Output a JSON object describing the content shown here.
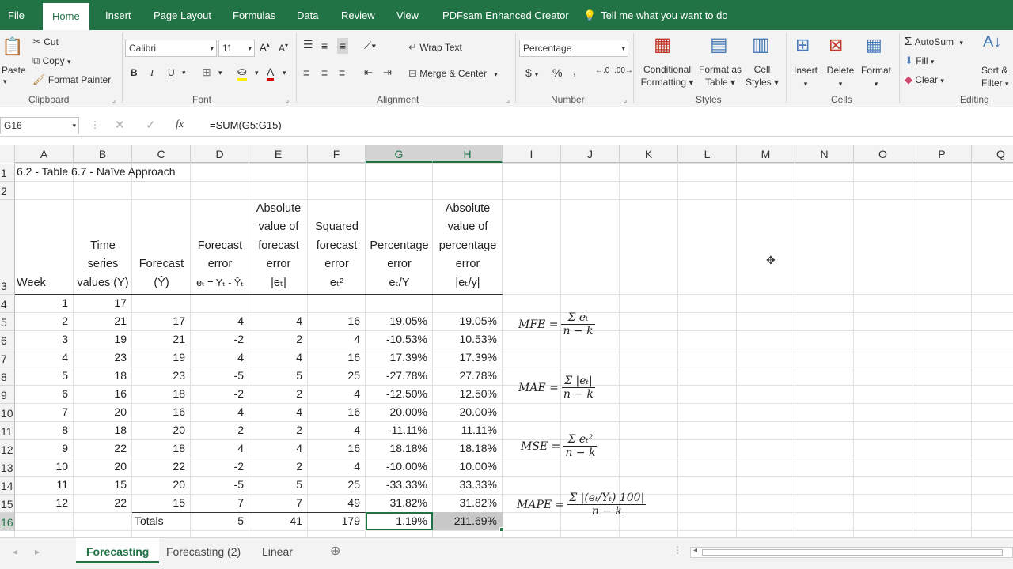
{
  "ribbon_tabs": [
    "File",
    "Home",
    "Insert",
    "Page Layout",
    "Formulas",
    "Data",
    "Review",
    "View",
    "PDFsam Enhanced Creator"
  ],
  "tell_me": "Tell me what you want to do",
  "clipboard": {
    "paste": "Paste",
    "cut": "Cut",
    "copy": "Copy",
    "format_painter": "Format Painter",
    "group": "Clipboard"
  },
  "font": {
    "name": "Calibri",
    "size": "11",
    "bold": "B",
    "italic": "I",
    "underline": "U",
    "grow": "A",
    "shrink": "A",
    "group": "Font"
  },
  "alignment": {
    "wrap_text": "Wrap Text",
    "merge_center": "Merge & Center",
    "group": "Alignment"
  },
  "number": {
    "format": "Percentage",
    "currency": "$",
    "percent": "%",
    "comma": ",",
    "group": "Number"
  },
  "styles": {
    "conditional": "Conditional",
    "formatting": "Formatting",
    "format_as": "Format as",
    "table": "Table",
    "cell": "Cell",
    "cell_styles": "Styles",
    "group": "Styles"
  },
  "cells": {
    "insert": "Insert",
    "delete": "Delete",
    "format": "Format",
    "group": "Cells"
  },
  "editing": {
    "autosum": "AutoSum",
    "fill": "Fill",
    "clear": "Clear",
    "sort": "Sort &",
    "filter": "Filter",
    "group": "Editing"
  },
  "formula_bar": {
    "name_box": "G16",
    "fx": "fx",
    "formula": "=SUM(G5:G15)"
  },
  "columns": [
    "A",
    "B",
    "C",
    "D",
    "E",
    "F",
    "G",
    "H",
    "I",
    "J",
    "K",
    "L",
    "M",
    "N",
    "O",
    "P",
    "Q"
  ],
  "rows": [
    "1",
    "2",
    "3",
    "4",
    "5",
    "6",
    "7",
    "8",
    "9",
    "10",
    "11",
    "12",
    "13",
    "14",
    "15",
    "16"
  ],
  "title": "6.2 - Table 6.7 - Naïve Approach",
  "headers": {
    "A": "Week",
    "B": [
      "Time",
      "series",
      "values (Y)"
    ],
    "C": [
      "Forecast",
      "(Ŷ)"
    ],
    "D": [
      "Forecast",
      "error",
      "eₜ = Yₜ - Ŷₜ"
    ],
    "E": [
      "Absolute",
      "value of",
      "forecast",
      "error",
      "|eₜ|"
    ],
    "F": [
      "Squared",
      "forecast",
      "error",
      "eₜ²"
    ],
    "G": [
      "Percentage",
      "error",
      "eₜ/Y"
    ],
    "H": [
      "Absolute",
      "value of",
      "percentage",
      "error",
      "|eₜ/y|"
    ]
  },
  "table": [
    [
      "1",
      "17",
      "",
      "",
      "",
      "",
      "",
      ""
    ],
    [
      "2",
      "21",
      "17",
      "4",
      "4",
      "16",
      "19.05%",
      "19.05%"
    ],
    [
      "3",
      "19",
      "21",
      "-2",
      "2",
      "4",
      "-10.53%",
      "10.53%"
    ],
    [
      "4",
      "23",
      "19",
      "4",
      "4",
      "16",
      "17.39%",
      "17.39%"
    ],
    [
      "5",
      "18",
      "23",
      "-5",
      "5",
      "25",
      "-27.78%",
      "27.78%"
    ],
    [
      "6",
      "16",
      "18",
      "-2",
      "2",
      "4",
      "-12.50%",
      "12.50%"
    ],
    [
      "7",
      "20",
      "16",
      "4",
      "4",
      "16",
      "20.00%",
      "20.00%"
    ],
    [
      "8",
      "18",
      "20",
      "-2",
      "2",
      "4",
      "-11.11%",
      "11.11%"
    ],
    [
      "9",
      "22",
      "18",
      "4",
      "4",
      "16",
      "18.18%",
      "18.18%"
    ],
    [
      "10",
      "20",
      "22",
      "-2",
      "2",
      "4",
      "-10.00%",
      "10.00%"
    ],
    [
      "11",
      "15",
      "20",
      "-5",
      "5",
      "25",
      "-33.33%",
      "33.33%"
    ],
    [
      "12",
      "22",
      "15",
      "7",
      "7",
      "49",
      "31.82%",
      "31.82%"
    ]
  ],
  "totals": {
    "label": "Totals",
    "D": "5",
    "E": "41",
    "F": "179",
    "G": "1.19%",
    "H": "211.69%"
  },
  "formulas": {
    "mfe": {
      "lhs": "MFE =",
      "num": "Σ eₜ",
      "den": "n − k"
    },
    "mae": {
      "lhs": "MAE =",
      "num": "Σ |eₜ|",
      "den": "n − k"
    },
    "mse": {
      "lhs": "MSE =",
      "num": "Σ eₜ²",
      "den": "n − k"
    },
    "mape": {
      "lhs": "MAPE =",
      "num": "Σ |(eₜ/Yₜ) 100|",
      "den": "n − k"
    }
  },
  "sheet_tabs": [
    "Forecasting",
    "Forecasting (2)",
    "Linear"
  ],
  "accent": "#217346"
}
